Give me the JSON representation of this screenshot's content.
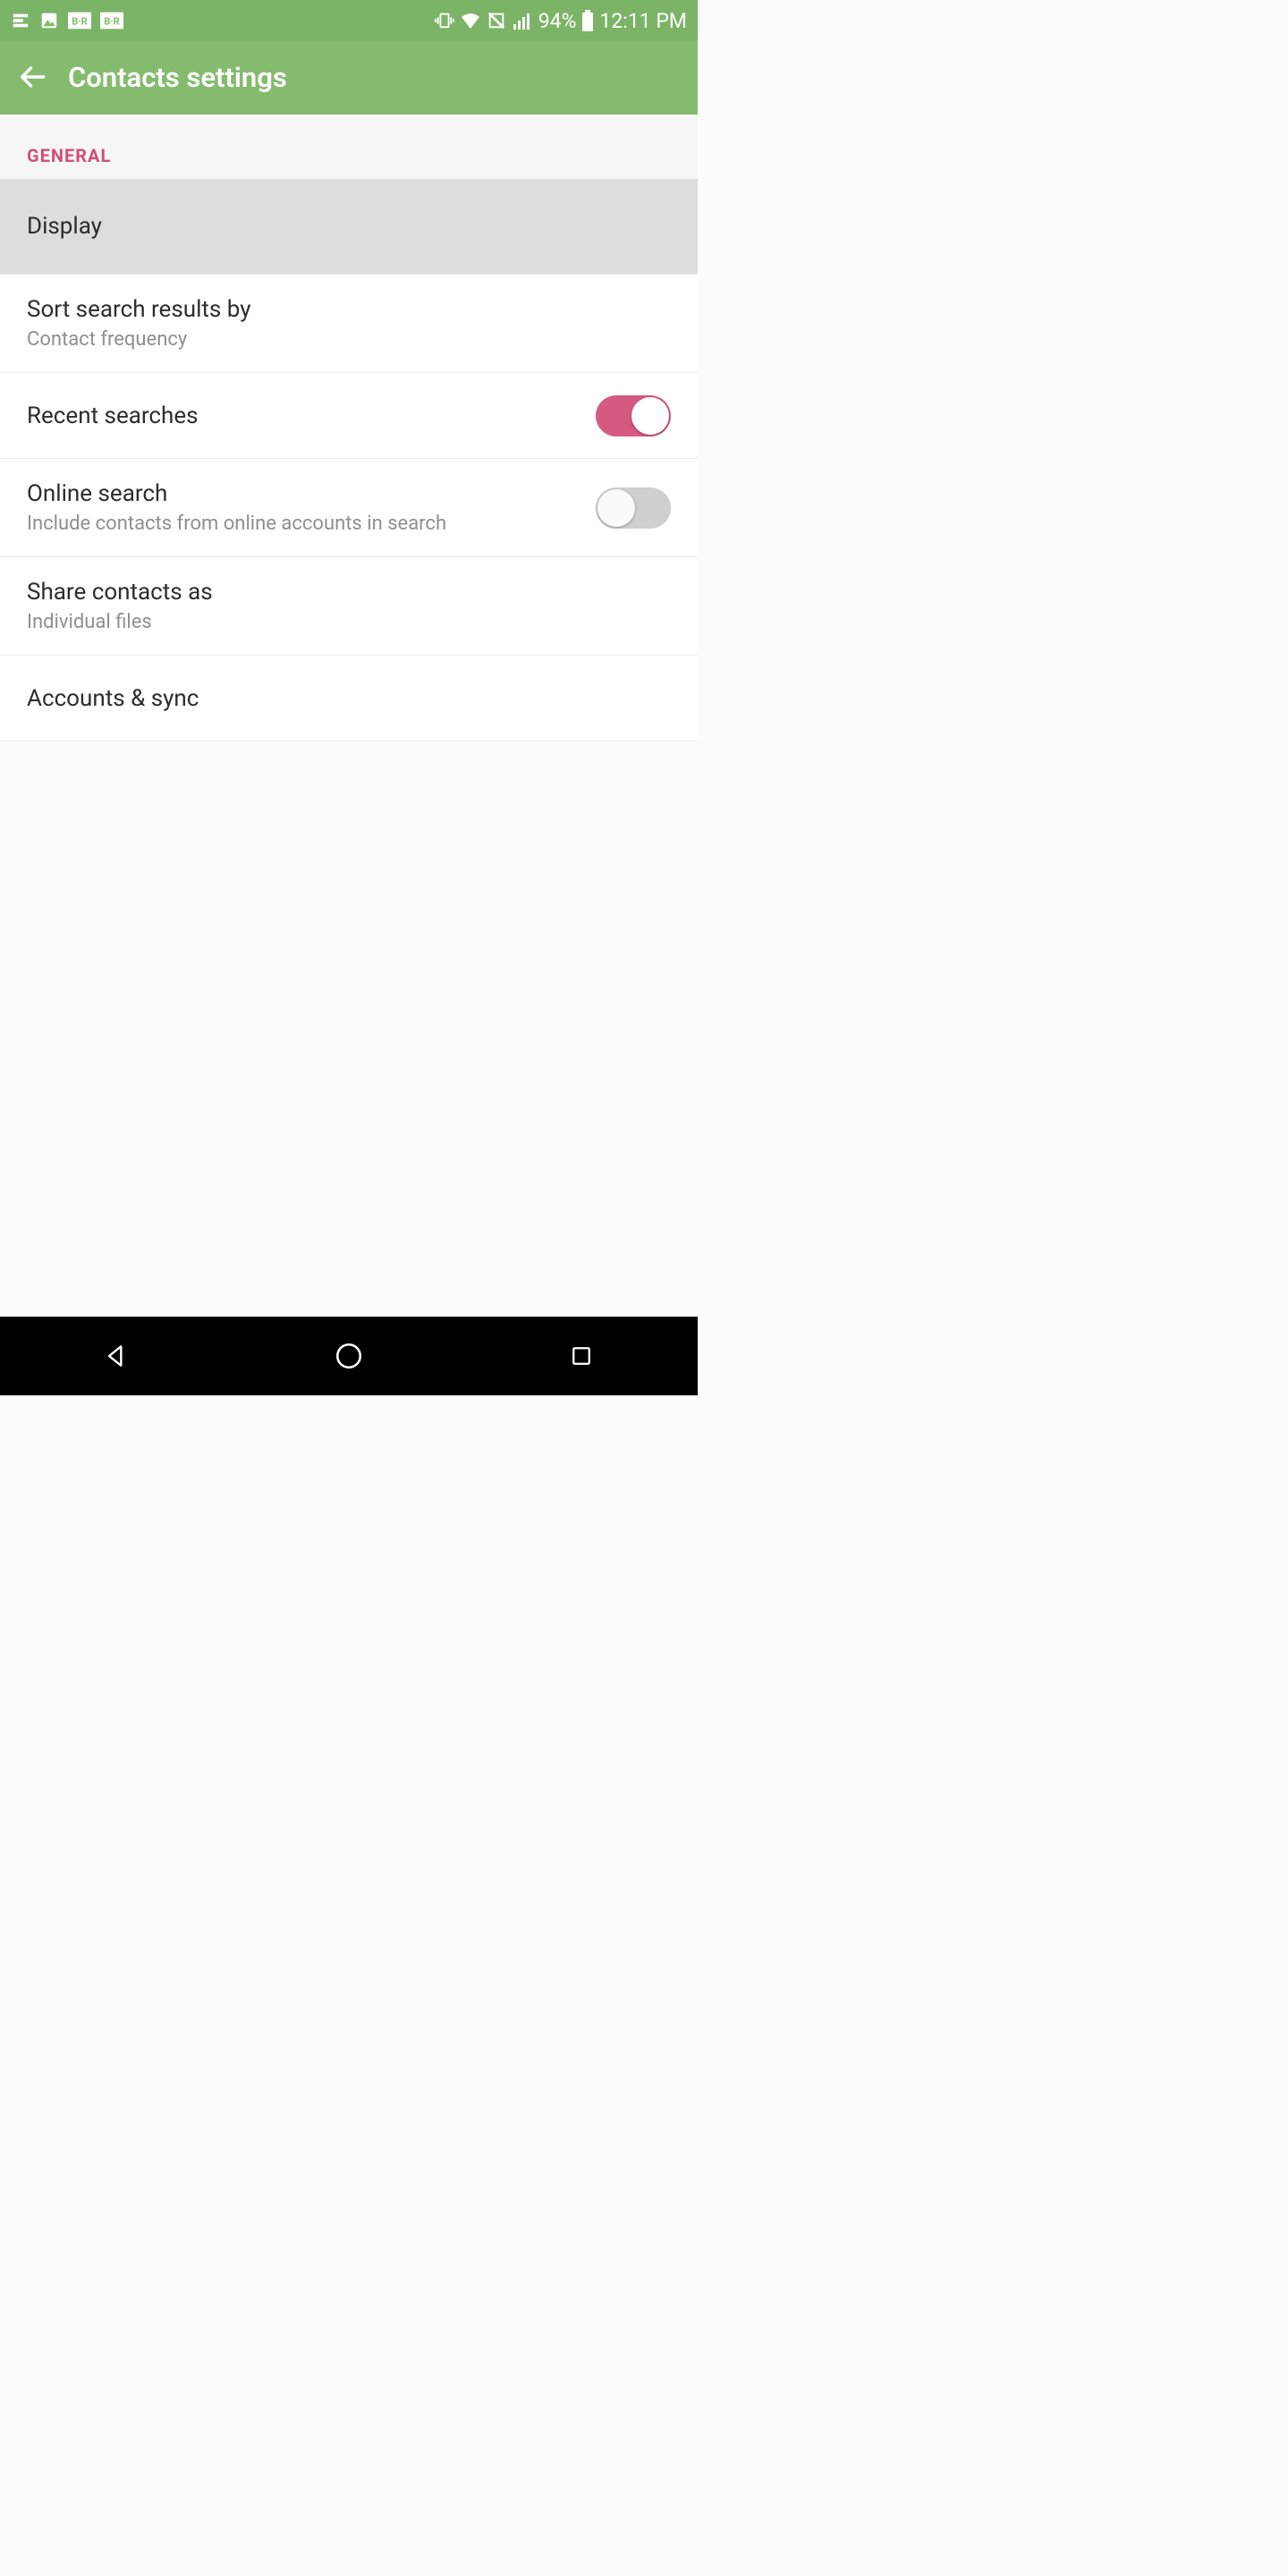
{
  "status": {
    "battery": "94%",
    "time": "12:11 PM",
    "notif_icons": [
      "e-icon",
      "picture-icon",
      "br-icon",
      "br-icon"
    ],
    "sys_icons": [
      "vibrate-icon",
      "wifi-icon",
      "nfc-off-icon",
      "signal-icon",
      "battery-icon"
    ]
  },
  "appbar": {
    "title": "Contacts settings"
  },
  "section": {
    "label": "GENERAL"
  },
  "rows": {
    "display": {
      "title": "Display"
    },
    "sort": {
      "title": "Sort search results by",
      "sub": "Contact frequency"
    },
    "recent": {
      "title": "Recent searches"
    },
    "online": {
      "title": "Online search",
      "sub": "Include contacts from online accounts in search"
    },
    "share": {
      "title": "Share contacts as",
      "sub": "Individual files"
    },
    "accounts": {
      "title": "Accounts & sync"
    }
  },
  "toggles": {
    "recent": true,
    "online": false
  },
  "colors": {
    "accent_green": "#85bb6f",
    "accent_pink": "#d65a80",
    "section_pink": "#cf5078"
  }
}
